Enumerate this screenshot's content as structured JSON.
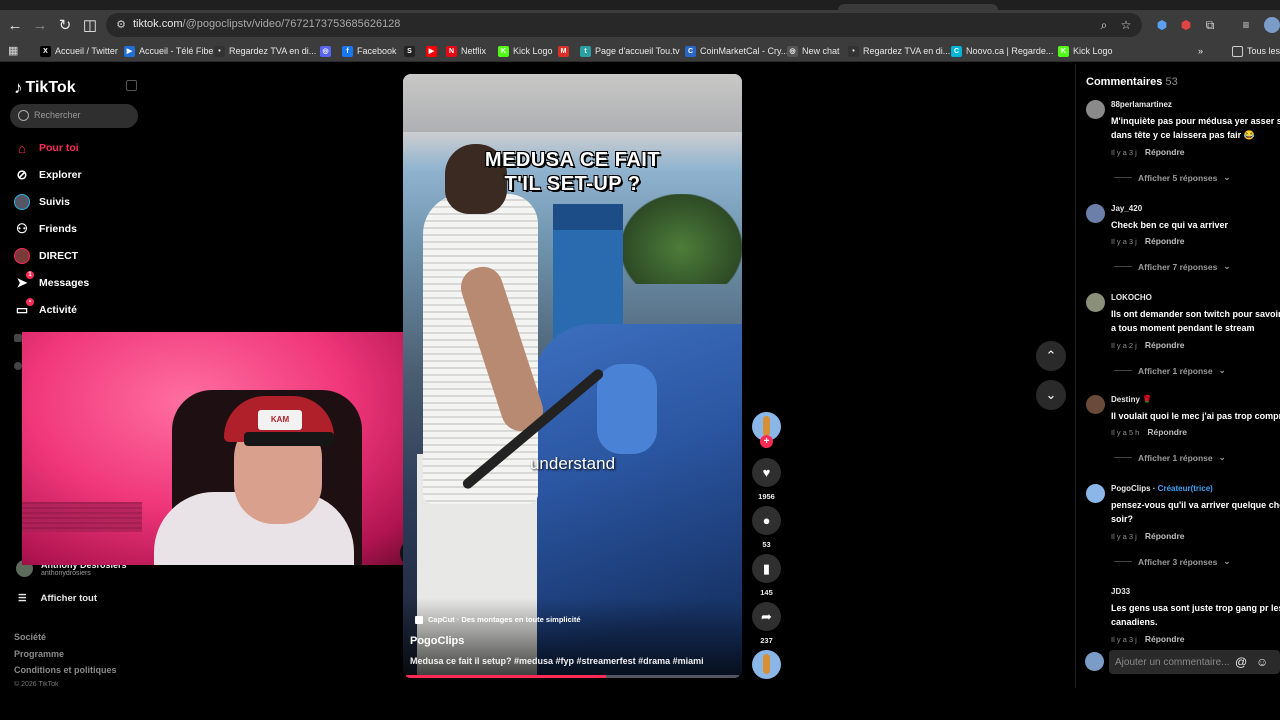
{
  "browser": {
    "url_domain": "tiktok.com",
    "url_path": "/@pogoclipstv/video/7672173753685626128",
    "bookmarks": [
      {
        "label": "Accueil / Twitter",
        "icon": "x-logo-icon",
        "color": "#000000",
        "glyph": "X"
      },
      {
        "label": "Accueil - Télé Fibe",
        "icon": "fibe-icon",
        "color": "#1f6fd6",
        "glyph": "▶"
      },
      {
        "label": "Regardez TVA en di...",
        "icon": "tva-icon",
        "color": "#333333",
        "glyph": "•"
      },
      {
        "label": "",
        "icon": "discord-icon",
        "color": "#5865f2",
        "glyph": "◎"
      },
      {
        "label": "Facebook",
        "icon": "facebook-icon",
        "color": "#1877f2",
        "glyph": "f"
      },
      {
        "label": "",
        "icon": "s-logo-icon",
        "color": "#222222",
        "glyph": "S"
      },
      {
        "label": "",
        "icon": "youtube-icon",
        "color": "#ff0000",
        "glyph": "▶"
      },
      {
        "label": "Netflix",
        "icon": "netflix-icon",
        "color": "#e50914",
        "glyph": "N"
      },
      {
        "label": "Kick Logo",
        "icon": "kick-icon",
        "color": "#53fc18",
        "glyph": "K"
      },
      {
        "label": "",
        "icon": "gmail-icon",
        "color": "#d93025",
        "glyph": "M"
      },
      {
        "label": "Page d'accueil Tou.tv",
        "icon": "toutv-icon",
        "color": "#2aa0a0",
        "glyph": "t"
      },
      {
        "label": "CoinMarketCal - Cry...",
        "icon": "coinmarketcal-icon",
        "color": "#2a66c8",
        "glyph": "C"
      },
      {
        "label": "New chat",
        "icon": "chatgpt-icon",
        "color": "#555555",
        "glyph": "◎"
      },
      {
        "label": "Regardez TVA en di...",
        "icon": "tva-icon",
        "color": "#333333",
        "glyph": "•"
      },
      {
        "label": "Noovo.ca | Regarde...",
        "icon": "noovo-icon",
        "color": "#00b5d8",
        "glyph": "C"
      },
      {
        "label": "Kick Logo",
        "icon": "kick-icon",
        "color": "#53fc18",
        "glyph": "K"
      }
    ],
    "other_bookmarks": "Tous les"
  },
  "sidebar": {
    "brand": "TikTok",
    "search_placeholder": "Rechercher",
    "nav": [
      {
        "label": "Pour toi",
        "icon": "home-icon",
        "active": true
      },
      {
        "label": "Explorer",
        "icon": "compass-icon"
      },
      {
        "label": "Suivis",
        "icon": "following-avatar-icon"
      },
      {
        "label": "Friends",
        "icon": "friends-icon"
      },
      {
        "label": "DIRECT",
        "icon": "live-icon"
      },
      {
        "label": "Messages",
        "icon": "messages-icon",
        "badge": "1"
      },
      {
        "label": "Activité",
        "icon": "activity-icon",
        "badge": "•"
      }
    ],
    "following_account": {
      "name": "Anthony Desrosiers",
      "handle": "anthonydrosiers"
    },
    "see_all": "Afficher tout",
    "footer": [
      "Société",
      "Programme",
      "Conditions et politiques"
    ],
    "copyright": "© 2026 TikTok"
  },
  "webcam": {
    "cap_text": "KAM"
  },
  "video": {
    "overlay_line1": "MEDUSA CE FAIT",
    "overlay_line2": "T'IL SET-UP ?",
    "caption": "understand",
    "capcut": "CapCut · Des montages en toute simplicité",
    "author": "PogoClips",
    "description": "Medusa ce fait il setup? #medusa #fyp #streamerfest #drama #miami",
    "progress_fraction": 0.6
  },
  "actions": {
    "likes": "1956",
    "comments": "53",
    "saves": "145",
    "shares": "237"
  },
  "comments_panel": {
    "title": "Commentaires",
    "count": "53",
    "items": [
      {
        "user": "88perlamartinez",
        "text": "M'inquiète pas pour médusa yer asser sauter dans tête y ce laissera pas fair 😂",
        "time": "Il y a 3 j",
        "reply": "Répondre",
        "replies": "Afficher 5 réponses",
        "avatar": "#8a8a8a"
      },
      {
        "user": "Jay_420",
        "text": "Check ben ce qui va arriver",
        "time": "Il y a 3 j",
        "reply": "Répondre",
        "replies": "Afficher 7 réponses",
        "avatar": "#6b7fa8"
      },
      {
        "user": "LOKOCHO",
        "text": "Ils ont demander son twitch pour savoir est ou a tous moment pendant le stream",
        "time": "Il y a 2 j",
        "reply": "Répondre",
        "replies": "Afficher 1 réponse",
        "avatar": "#8a8f7a"
      },
      {
        "user": "Destiny 🌹",
        "text": "Il voulait quoi le mec j'ai pas trop compris",
        "time": "Il y a 5 h",
        "reply": "Répondre",
        "replies": "Afficher 1 réponse",
        "avatar": "#6a4a3a"
      },
      {
        "user": "PogoClips",
        "creator": "Créateur(trice)",
        "text": "pensez-vous qu'il va arriver quelque chose ce soir?",
        "time": "Il y a 3 j",
        "reply": "Répondre",
        "replies": "Afficher 3 réponses",
        "avatar": "#8bb6e8"
      },
      {
        "user": "JD33",
        "text": "Les gens usa sont juste trop gang pr les canadiens.",
        "time": "Il y a 3 j",
        "reply": "Répondre",
        "avatar": "#000000"
      }
    ],
    "input_placeholder": "Ajouter un commentaire..."
  }
}
